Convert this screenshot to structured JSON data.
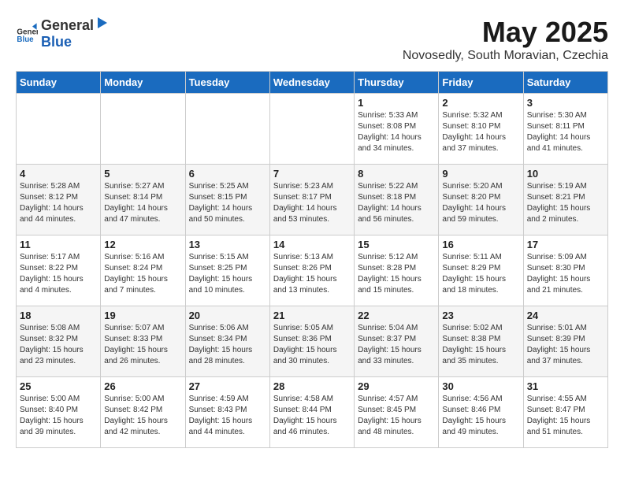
{
  "logo": {
    "general": "General",
    "blue": "Blue"
  },
  "title": "May 2025",
  "subtitle": "Novosedly, South Moravian, Czechia",
  "days_of_week": [
    "Sunday",
    "Monday",
    "Tuesday",
    "Wednesday",
    "Thursday",
    "Friday",
    "Saturday"
  ],
  "weeks": [
    [
      {
        "day": "",
        "content": ""
      },
      {
        "day": "",
        "content": ""
      },
      {
        "day": "",
        "content": ""
      },
      {
        "day": "",
        "content": ""
      },
      {
        "day": "1",
        "content": "Sunrise: 5:33 AM\nSunset: 8:08 PM\nDaylight: 14 hours\nand 34 minutes."
      },
      {
        "day": "2",
        "content": "Sunrise: 5:32 AM\nSunset: 8:10 PM\nDaylight: 14 hours\nand 37 minutes."
      },
      {
        "day": "3",
        "content": "Sunrise: 5:30 AM\nSunset: 8:11 PM\nDaylight: 14 hours\nand 41 minutes."
      }
    ],
    [
      {
        "day": "4",
        "content": "Sunrise: 5:28 AM\nSunset: 8:12 PM\nDaylight: 14 hours\nand 44 minutes."
      },
      {
        "day": "5",
        "content": "Sunrise: 5:27 AM\nSunset: 8:14 PM\nDaylight: 14 hours\nand 47 minutes."
      },
      {
        "day": "6",
        "content": "Sunrise: 5:25 AM\nSunset: 8:15 PM\nDaylight: 14 hours\nand 50 minutes."
      },
      {
        "day": "7",
        "content": "Sunrise: 5:23 AM\nSunset: 8:17 PM\nDaylight: 14 hours\nand 53 minutes."
      },
      {
        "day": "8",
        "content": "Sunrise: 5:22 AM\nSunset: 8:18 PM\nDaylight: 14 hours\nand 56 minutes."
      },
      {
        "day": "9",
        "content": "Sunrise: 5:20 AM\nSunset: 8:20 PM\nDaylight: 14 hours\nand 59 minutes."
      },
      {
        "day": "10",
        "content": "Sunrise: 5:19 AM\nSunset: 8:21 PM\nDaylight: 15 hours\nand 2 minutes."
      }
    ],
    [
      {
        "day": "11",
        "content": "Sunrise: 5:17 AM\nSunset: 8:22 PM\nDaylight: 15 hours\nand 4 minutes."
      },
      {
        "day": "12",
        "content": "Sunrise: 5:16 AM\nSunset: 8:24 PM\nDaylight: 15 hours\nand 7 minutes."
      },
      {
        "day": "13",
        "content": "Sunrise: 5:15 AM\nSunset: 8:25 PM\nDaylight: 15 hours\nand 10 minutes."
      },
      {
        "day": "14",
        "content": "Sunrise: 5:13 AM\nSunset: 8:26 PM\nDaylight: 15 hours\nand 13 minutes."
      },
      {
        "day": "15",
        "content": "Sunrise: 5:12 AM\nSunset: 8:28 PM\nDaylight: 15 hours\nand 15 minutes."
      },
      {
        "day": "16",
        "content": "Sunrise: 5:11 AM\nSunset: 8:29 PM\nDaylight: 15 hours\nand 18 minutes."
      },
      {
        "day": "17",
        "content": "Sunrise: 5:09 AM\nSunset: 8:30 PM\nDaylight: 15 hours\nand 21 minutes."
      }
    ],
    [
      {
        "day": "18",
        "content": "Sunrise: 5:08 AM\nSunset: 8:32 PM\nDaylight: 15 hours\nand 23 minutes."
      },
      {
        "day": "19",
        "content": "Sunrise: 5:07 AM\nSunset: 8:33 PM\nDaylight: 15 hours\nand 26 minutes."
      },
      {
        "day": "20",
        "content": "Sunrise: 5:06 AM\nSunset: 8:34 PM\nDaylight: 15 hours\nand 28 minutes."
      },
      {
        "day": "21",
        "content": "Sunrise: 5:05 AM\nSunset: 8:36 PM\nDaylight: 15 hours\nand 30 minutes."
      },
      {
        "day": "22",
        "content": "Sunrise: 5:04 AM\nSunset: 8:37 PM\nDaylight: 15 hours\nand 33 minutes."
      },
      {
        "day": "23",
        "content": "Sunrise: 5:02 AM\nSunset: 8:38 PM\nDaylight: 15 hours\nand 35 minutes."
      },
      {
        "day": "24",
        "content": "Sunrise: 5:01 AM\nSunset: 8:39 PM\nDaylight: 15 hours\nand 37 minutes."
      }
    ],
    [
      {
        "day": "25",
        "content": "Sunrise: 5:00 AM\nSunset: 8:40 PM\nDaylight: 15 hours\nand 39 minutes."
      },
      {
        "day": "26",
        "content": "Sunrise: 5:00 AM\nSunset: 8:42 PM\nDaylight: 15 hours\nand 42 minutes."
      },
      {
        "day": "27",
        "content": "Sunrise: 4:59 AM\nSunset: 8:43 PM\nDaylight: 15 hours\nand 44 minutes."
      },
      {
        "day": "28",
        "content": "Sunrise: 4:58 AM\nSunset: 8:44 PM\nDaylight: 15 hours\nand 46 minutes."
      },
      {
        "day": "29",
        "content": "Sunrise: 4:57 AM\nSunset: 8:45 PM\nDaylight: 15 hours\nand 48 minutes."
      },
      {
        "day": "30",
        "content": "Sunrise: 4:56 AM\nSunset: 8:46 PM\nDaylight: 15 hours\nand 49 minutes."
      },
      {
        "day": "31",
        "content": "Sunrise: 4:55 AM\nSunset: 8:47 PM\nDaylight: 15 hours\nand 51 minutes."
      }
    ]
  ]
}
